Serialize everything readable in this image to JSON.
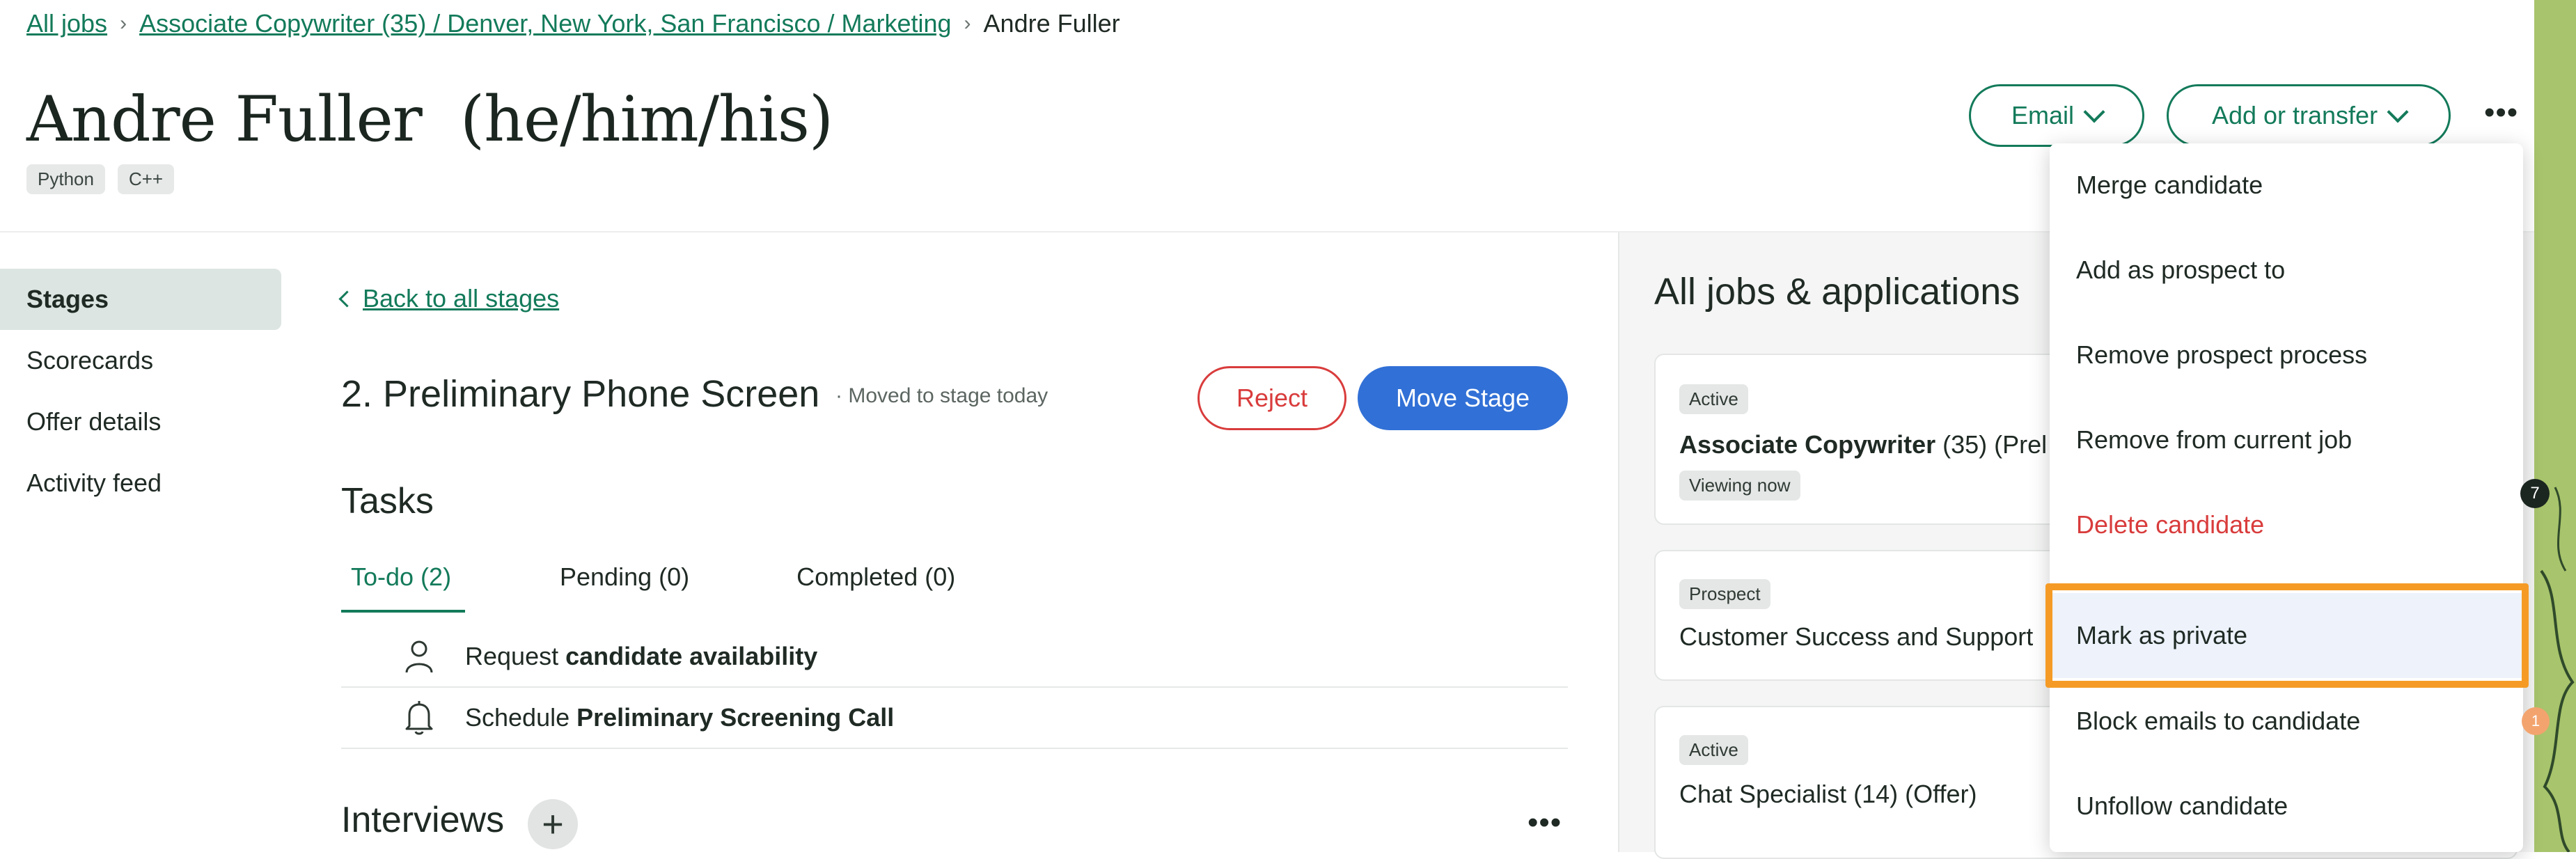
{
  "breadcrumb": {
    "all_jobs": "All jobs",
    "job": "Associate Copywriter (35) / Denver, New York, San Francisco / Marketing",
    "current": "Andre Fuller"
  },
  "candidate": {
    "name": "Andre Fuller",
    "pronouns": "(he/him/his)",
    "tags": [
      "Python",
      "C++"
    ]
  },
  "header_actions": {
    "email_label": "Email",
    "add_transfer_label": "Add or transfer"
  },
  "nav": {
    "items": [
      {
        "label": "Stages",
        "active": true
      },
      {
        "label": "Scorecards"
      },
      {
        "label": "Offer details"
      },
      {
        "label": "Activity feed"
      }
    ]
  },
  "stage": {
    "back_label": "Back to all stages",
    "title": "2. Preliminary Phone Screen",
    "subtitle": "Moved to stage today",
    "reject_label": "Reject",
    "move_label": "Move Stage"
  },
  "tasks": {
    "title": "Tasks",
    "tabs": [
      "To-do (2)",
      "Pending (0)",
      "Completed (0)"
    ],
    "items": [
      {
        "prefix": "Request",
        "bold": "candidate availability",
        "icon": "person-icon"
      },
      {
        "prefix": "Schedule",
        "bold": "Preliminary Screening Call",
        "icon": "bell-icon"
      }
    ]
  },
  "interviews": {
    "title": "Interviews"
  },
  "applications": {
    "title": "All jobs & applications",
    "cards": [
      {
        "status": "Active",
        "job": "Associate Copywriter",
        "rest": " (35) (Prel",
        "viewing": "Viewing now"
      },
      {
        "status": "Prospect",
        "job": "Customer Success and Support"
      },
      {
        "status": "Active",
        "job": "Chat Specialist (14) (Offer)"
      }
    ],
    "counter_7": "7",
    "counter_1": "1"
  },
  "menu": {
    "items": [
      {
        "label": "Merge candidate"
      },
      {
        "label": "Add as prospect to"
      },
      {
        "label": "Remove prospect process"
      },
      {
        "label": "Remove from current job"
      },
      {
        "label": "Delete candidate",
        "danger": true
      },
      {
        "label": "Mark as private",
        "highlighted": true
      },
      {
        "label": "Block emails to candidate"
      },
      {
        "label": "Unfollow candidate"
      }
    ]
  },
  "colors": {
    "brand_green": "#137a5a",
    "primary_blue": "#3170d6",
    "danger_red": "#d93c3c",
    "highlight_orange": "#f59b25"
  }
}
